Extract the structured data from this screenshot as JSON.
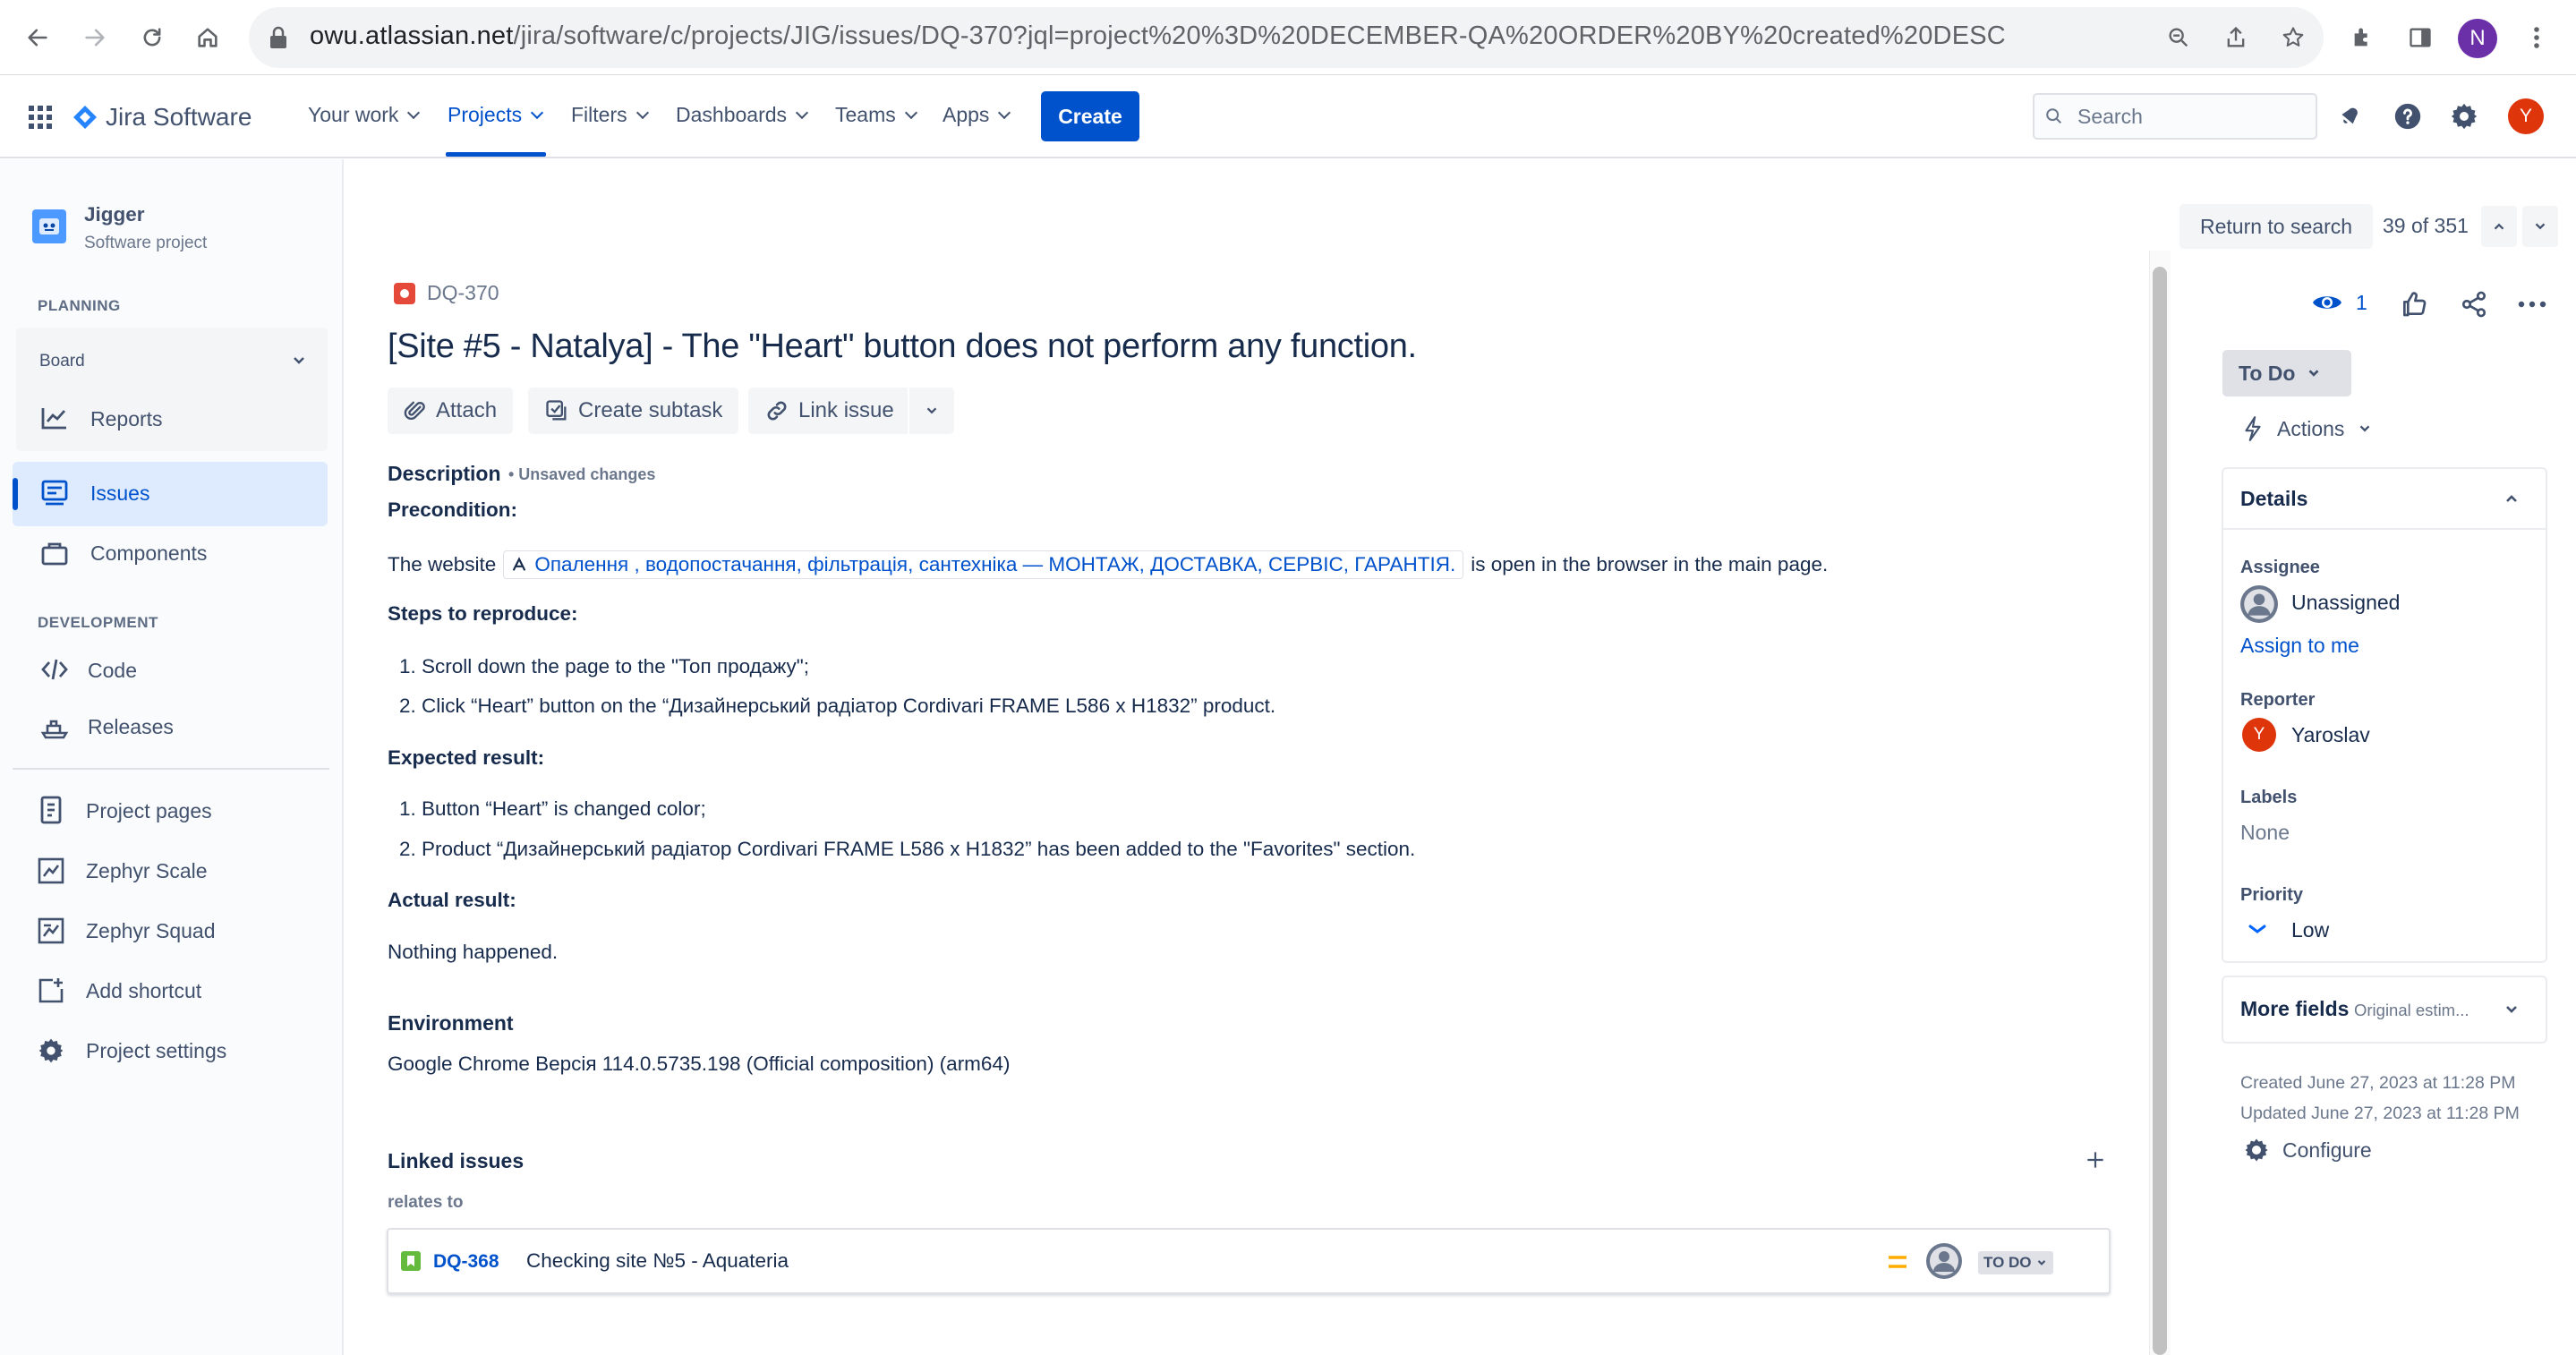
{
  "browser": {
    "url_host": "owu.atlassian.net",
    "url_path": "/jira/software/c/projects/JIG/issues/DQ-370?jql=project%20%3D%20DECEMBER-QA%20ORDER%20BY%20created%20DESC",
    "profile_initial": "N"
  },
  "topnav": {
    "product": "Jira Software",
    "items": [
      "Your work",
      "Projects",
      "Filters",
      "Dashboards",
      "Teams",
      "Apps"
    ],
    "create_label": "Create",
    "search_placeholder": "Search",
    "user_initial": "Y",
    "colors": {
      "brand": "#0052CC",
      "avatar": "#DE350B"
    }
  },
  "sidebar": {
    "project_name": "Jigger",
    "project_type": "Software project",
    "planning_heading": "PLANNING",
    "board_label": "Board",
    "reports_label": "Reports",
    "issues_label": "Issues",
    "components_label": "Components",
    "development_heading": "DEVELOPMENT",
    "code_label": "Code",
    "releases_label": "Releases",
    "project_pages_label": "Project pages",
    "zephyr_scale_label": "Zephyr Scale",
    "zephyr_squad_label": "Zephyr Squad",
    "add_shortcut_label": "Add shortcut",
    "project_settings_label": "Project settings"
  },
  "issue": {
    "key": "DQ-370",
    "title": "[Site #5 - Natalya] - The \"Heart\" button does not perform any function.",
    "toolbar": {
      "attach": "Attach",
      "create_subtask": "Create subtask",
      "link_issue": "Link issue"
    },
    "description_label": "Description",
    "unsaved_changes": "• Unsaved changes",
    "precondition_heading": "Precondition:",
    "precondition_prefix": "The website",
    "precondition_link": "Опалення , водопостачання, фільтрація, сантехніка — МОНТАЖ, ДОСТАВКА, СЕРВІС, ГАРАНТІЯ.",
    "precondition_suffix": "is open in the browser in the main page.",
    "steps_heading": "Steps to reproduce:",
    "steps": [
      "Scroll down the page to the \"Топ продажу\";",
      "Click “Heart” button on the “Дизайнерський радіатор Cordivari FRAME L586 x H1832” product."
    ],
    "expected_heading": "Expected result:",
    "expected": [
      "Button “Heart” is changed color;",
      "Product “Дизайнерський радіатор Cordivari FRAME L586 x H1832” has been added to the \"Favorites\" section."
    ],
    "actual_heading": "Actual result:",
    "actual_text": "Nothing happened.",
    "environment_label": "Environment",
    "environment_value": "Google Chrome Версія 114.0.5735.198 (Official composition) (arm64)",
    "linked_issues_label": "Linked issues",
    "relation": "relates to",
    "linked": {
      "key": "DQ-368",
      "summary": "Checking site №5 - Aquateria",
      "status": "TO DO"
    }
  },
  "nav": {
    "return_to_search": "Return to search",
    "position": "39 of 351"
  },
  "panel": {
    "watchers": "1",
    "status": "To Do",
    "actions_label": "Actions",
    "details_heading": "Details",
    "assignee_label": "Assignee",
    "assignee_value": "Unassigned",
    "assign_to_me": "Assign to me",
    "reporter_label": "Reporter",
    "reporter_value": "Yaroslav",
    "reporter_initial": "Y",
    "labels_label": "Labels",
    "labels_value": "None",
    "priority_label": "Priority",
    "priority_value": "Low",
    "more_fields": "More fields",
    "more_fields_hint": "Original estim...",
    "created": "Created June 27, 2023 at 11:28 PM",
    "updated": "Updated June 27, 2023 at 11:28 PM",
    "configure": "Configure"
  }
}
